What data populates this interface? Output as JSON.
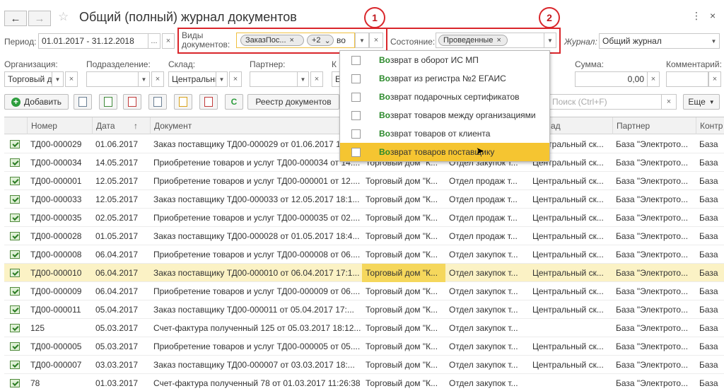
{
  "window": {
    "title": "Общий (полный) журнал документов",
    "back_icon": "←",
    "forward_icon": "→",
    "star_icon": "☆",
    "more_icon": "⋮",
    "close_icon": "×"
  },
  "filters": {
    "period_label": "Период:",
    "period_value": "01.01.2017 - 31.12.2018",
    "period_more": "...",
    "doc_types_label": "Виды документов:",
    "doc_types_chips": [
      {
        "label": "ЗаказПос..."
      },
      {
        "label": "+2"
      }
    ],
    "doc_types_input": "во",
    "state_label": "Состояние:",
    "state_chip": "Проведенные",
    "journal_label": "Журнал:",
    "journal_value": "Общий журнал",
    "organization_label": "Организация:",
    "organization_value": "Торговый д",
    "subdivision_label": "Подразделение:",
    "warehouse_label": "Склад:",
    "warehouse_value": "Центральны",
    "partner_label": "Партнер:",
    "contractor_label_partial": "К",
    "contractor_value_partial": "Е",
    "sum_label": "Сумма:",
    "sum_value": "0,00",
    "comment_label": "Комментарий:"
  },
  "toolbar": {
    "add_label": "Добавить",
    "refresh_icon": "C",
    "registry_label": "Реестр документов",
    "search_placeholder": "Поиск (Ctrl+F)",
    "more_label": "Еще"
  },
  "annotations": {
    "first": "1",
    "second": "2"
  },
  "popup": {
    "items": [
      {
        "match": "Во",
        "rest": "зврат в оборот ИС МП"
      },
      {
        "match": "Во",
        "rest": "зврат из регистра №2 ЕГАИС"
      },
      {
        "match": "Во",
        "rest": "зврат подарочных сертификатов"
      },
      {
        "match": "Во",
        "rest": "зврат товаров между организациями"
      },
      {
        "match": "Во",
        "rest": "зврат товаров от клиента"
      },
      {
        "match": "Во",
        "rest": "зврат товаров поставщику"
      }
    ],
    "active_index": 5
  },
  "table": {
    "headers": [
      "Номер",
      "Дата",
      "Документ",
      "ад",
      "Партнер",
      "Контр"
    ],
    "sort_icon": "↑",
    "rows": [
      {
        "num": "ТД00-000029",
        "date": "01.06.2017",
        "doc": "Заказ поставщику ТД00-000029 от 01.06.2017 16",
        "org": "",
        "div": "",
        "wh": "Центральный ск...",
        "partner": "База \"Электрото...",
        "c": "База"
      },
      {
        "num": "ТД00-000034",
        "date": "14.05.2017",
        "doc": "Приобретение товаров и услуг ТД00-000034 от 14....",
        "org": "Торговый дом \"К...",
        "div": "Отдел закупок т...",
        "wh": "Центральный ск...",
        "partner": "База \"Электрото...",
        "c": "База"
      },
      {
        "num": "ТД00-000001",
        "date": "12.05.2017",
        "doc": "Приобретение товаров и услуг ТД00-000001 от 12....",
        "org": "Торговый дом \"К...",
        "div": "Отдел продаж т...",
        "wh": "Центральный ск...",
        "partner": "База \"Электрото...",
        "c": "База"
      },
      {
        "num": "ТД00-000033",
        "date": "12.05.2017",
        "doc": "Заказ поставщику ТД00-000033 от 12.05.2017 18:1...",
        "org": "Торговый дом \"К...",
        "div": "Отдел продаж т...",
        "wh": "Центральный ск...",
        "partner": "База \"Электрото...",
        "c": "База"
      },
      {
        "num": "ТД00-000035",
        "date": "02.05.2017",
        "doc": "Приобретение товаров и услуг ТД00-000035 от 02....",
        "org": "Торговый дом \"К...",
        "div": "Отдел продаж т...",
        "wh": "Центральный ск...",
        "partner": "База \"Электрото...",
        "c": "База"
      },
      {
        "num": "ТД00-000028",
        "date": "01.05.2017",
        "doc": "Заказ поставщику ТД00-000028 от 01.05.2017 18:4...",
        "org": "Торговый дом \"К...",
        "div": "Отдел продаж т...",
        "wh": "Центральный ск...",
        "partner": "База \"Электрото...",
        "c": "База"
      },
      {
        "num": "ТД00-000008",
        "date": "06.04.2017",
        "doc": "Приобретение товаров и услуг ТД00-000008 от 06....",
        "org": "Торговый дом \"К...",
        "div": "Отдел закупок т...",
        "wh": "Центральный ск...",
        "partner": "База \"Электрото...",
        "c": "База"
      },
      {
        "num": "ТД00-000010",
        "date": "06.04.2017",
        "doc": "Заказ поставщику ТД00-000010 от 06.04.2017 17:1...",
        "org": "Торговый дом \"К...",
        "div": "Отдел закупок т...",
        "wh": "Центральный ск...",
        "partner": "База \"Электрото...",
        "c": "База"
      },
      {
        "num": "ТД00-000009",
        "date": "06.04.2017",
        "doc": "Приобретение товаров и услуг ТД00-000009 от 06....",
        "org": "Торговый дом \"К...",
        "div": "Отдел закупок т...",
        "wh": "Центральный ск...",
        "partner": "База \"Электрото...",
        "c": "База"
      },
      {
        "num": "ТД00-000011",
        "date": "05.04.2017",
        "doc": "Заказ поставщику ТД00-000011 от 05.04.2017 17:...",
        "org": "Торговый дом \"К...",
        "div": "Отдел закупок т...",
        "wh": "Центральный ск...",
        "partner": "База \"Электрото...",
        "c": "База"
      },
      {
        "num": "125",
        "date": "05.03.2017",
        "doc": "Счет-фактура полученный 125 от 05.03.2017 18:12...",
        "org": "Торговый дом \"К...",
        "div": "Отдел закупок т...",
        "wh": "",
        "partner": "База \"Электрото...",
        "c": "База"
      },
      {
        "num": "ТД00-000005",
        "date": "05.03.2017",
        "doc": "Приобретение товаров и услуг ТД00-000005 от 05....",
        "org": "Торговый дом \"К...",
        "div": "Отдел закупок т...",
        "wh": "Центральный ск...",
        "partner": "База \"Электрото...",
        "c": "База"
      },
      {
        "num": "ТД00-000007",
        "date": "03.03.2017",
        "doc": "Заказ поставщику ТД00-000007 от 03.03.2017 18:...",
        "org": "Торговый дом \"К...",
        "div": "Отдел закупок т...",
        "wh": "Центральный ск...",
        "partner": "База \"Электрото...",
        "c": "База"
      },
      {
        "num": "78",
        "date": "01.03.2017",
        "doc": "Счет-фактура полученный 78 от 01.03.2017 11:26:38",
        "org": "Торговый дом \"К...",
        "div": "Отдел закупок т...",
        "wh": "",
        "partner": "База \"Электрото...",
        "c": "База"
      }
    ],
    "selected_index": 7
  },
  "colors": {
    "accent_red": "#d9262b",
    "selection": "#fbf2c5",
    "popup_active": "#f5c531",
    "match_green": "#2c8a2c"
  }
}
